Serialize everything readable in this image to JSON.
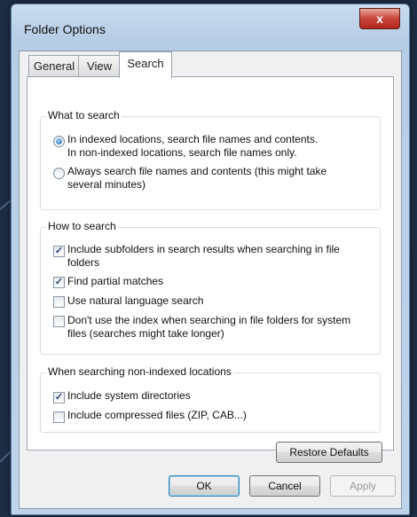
{
  "window": {
    "title": "Folder Options",
    "close_glyph": "x"
  },
  "tabs": [
    {
      "label": "General",
      "active": false
    },
    {
      "label": "View",
      "active": false
    },
    {
      "label": "Search",
      "active": true
    }
  ],
  "what_to_search": {
    "label": "What to search",
    "options": [
      {
        "line1": "In indexed locations, search file names and contents.",
        "line2": "In non-indexed locations, search file names only.",
        "selected": true
      },
      {
        "line1": "Always search file names and contents (this might take",
        "line2": "several minutes)",
        "selected": false
      }
    ]
  },
  "how_to_search": {
    "label": "How to search",
    "options": [
      {
        "line1": "Include subfolders in search results when searching in file",
        "line2": "folders",
        "checked": true
      },
      {
        "line1": "Find partial matches",
        "line2": "",
        "checked": true
      },
      {
        "line1": "Use natural language search",
        "line2": "",
        "checked": false
      },
      {
        "line1": "Don't use the index when searching in file folders for system",
        "line2": "files (searches might take longer)",
        "checked": false
      }
    ]
  },
  "non_indexed": {
    "label": "When searching non-indexed locations",
    "options": [
      {
        "line1": "Include system directories",
        "checked": true
      },
      {
        "line1": "Include compressed files (ZIP, CAB...)",
        "checked": false
      }
    ]
  },
  "buttons": {
    "restore": "Restore Defaults",
    "ok": "OK",
    "cancel": "Cancel",
    "apply": "Apply"
  },
  "check_glyph": "✓"
}
